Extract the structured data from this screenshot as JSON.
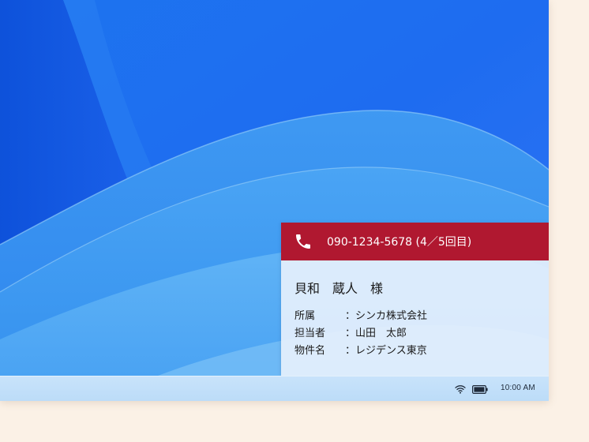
{
  "desktop": {
    "wallpaper": "blue-wave-wallpaper"
  },
  "notification": {
    "header_color": "#b01830",
    "icon": "phone-icon",
    "phone_line": "090-1234-5678 (4／5回目)",
    "caller_name": "貝和　蔵人　様",
    "details": [
      {
        "label": "所属",
        "value": "：シンカ株式会社"
      },
      {
        "label": "担当者",
        "value": "：山田　太郎"
      },
      {
        "label": "物件名",
        "value": "：レジデンス東京"
      }
    ]
  },
  "taskbar": {
    "wifi_icon": "wifi-icon",
    "battery_icon": "battery-icon",
    "clock": "10:00 AM"
  }
}
